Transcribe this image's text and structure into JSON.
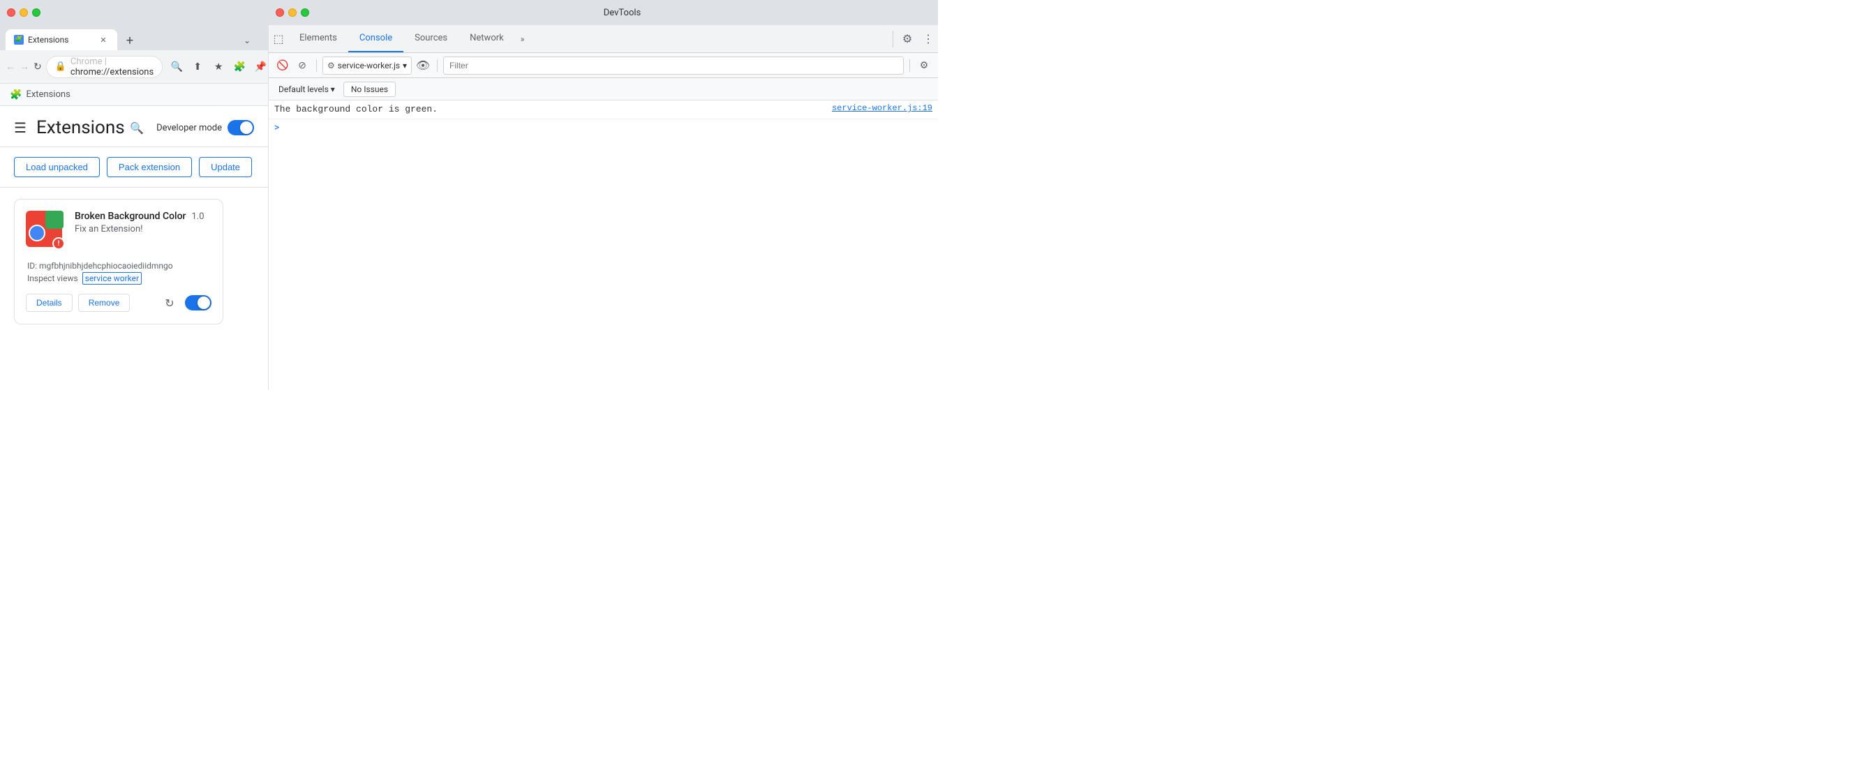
{
  "chrome": {
    "traffic_lights": [
      "red",
      "yellow",
      "green"
    ],
    "tab": {
      "label": "Extensions",
      "favicon": "🧩"
    },
    "url_bar": {
      "scheme": "chrome",
      "address": "chrome://extensions"
    },
    "breadcrumb": {
      "icon": "🧩",
      "label": "Extensions"
    },
    "extensions_page": {
      "hamburger": "☰",
      "title": "Extensions",
      "search_icon": "🔍",
      "developer_mode_label": "Developer mode",
      "developer_mode_on": true,
      "action_buttons": [
        "Load unpacked",
        "Pack extension",
        "Update"
      ],
      "card": {
        "name": "Broken Background Color",
        "version": "1.0",
        "description": "Fix an Extension!",
        "id_label": "ID: mgfbhjnibhjdehcphiocaoiediidmngo",
        "inspect_label": "Inspect views",
        "inspect_link": "service worker",
        "details_btn": "Details",
        "remove_btn": "Remove",
        "enabled": true
      }
    }
  },
  "devtools": {
    "title": "DevTools",
    "tabs": [
      {
        "label": "Elements",
        "active": false
      },
      {
        "label": "Console",
        "active": true
      },
      {
        "label": "Sources",
        "active": false
      },
      {
        "label": "Network",
        "active": false
      }
    ],
    "more_tabs": "»",
    "toolbar": {
      "context_selector": "service-worker.js",
      "filter_placeholder": "Filter"
    },
    "levels_label": "Default levels",
    "issues_label": "No Issues",
    "console_log": {
      "text": "The background color is green.",
      "source": "service-worker.js:19"
    },
    "prompt_arrow": ">"
  }
}
